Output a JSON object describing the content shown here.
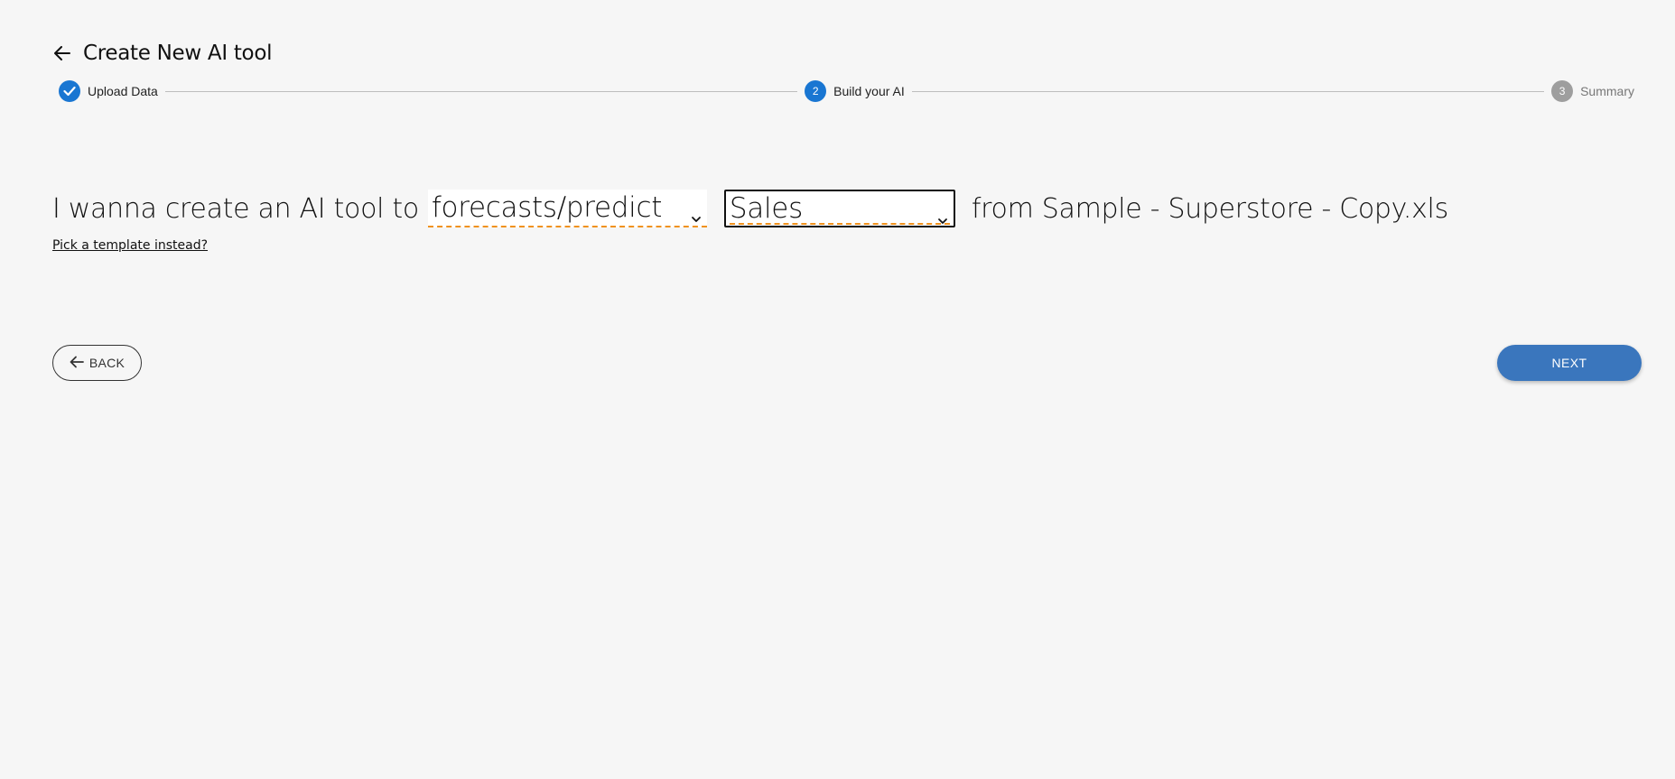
{
  "header": {
    "title": "Create New AI tool",
    "back_icon": "arrow-left-icon"
  },
  "stepper": {
    "steps": [
      {
        "number": "1",
        "label": "Upload Data",
        "state": "completed",
        "icon": "check-icon"
      },
      {
        "number": "2",
        "label": "Build your AI",
        "state": "active"
      },
      {
        "number": "3",
        "label": "Summary",
        "state": "inactive"
      }
    ]
  },
  "builder": {
    "prefix": "I wanna create an AI tool to",
    "action_select": {
      "value": "forecasts/predict"
    },
    "target_select": {
      "value": "Sales"
    },
    "suffix": "from Sample - Superstore - Copy.xls",
    "template_link": "Pick a template instead?"
  },
  "actions": {
    "back_label": "BACK",
    "next_label": "NEXT"
  },
  "colors": {
    "accent": "#1976d2",
    "next_button": "#3a76bd",
    "dashed_underline": "#f0921e",
    "background": "#f6f6f6"
  }
}
